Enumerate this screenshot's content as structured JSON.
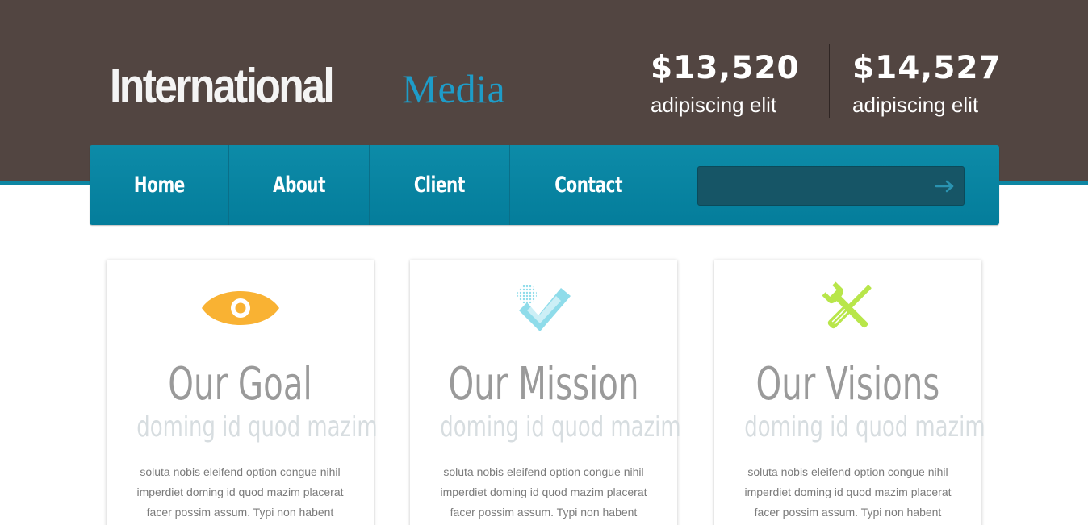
{
  "logo": {
    "main": "International",
    "sub": "Media"
  },
  "stats": [
    {
      "value": "$13,520",
      "label": "adipiscing elit"
    },
    {
      "value": "$14,527",
      "label": "adipiscing elit"
    }
  ],
  "nav": {
    "items": [
      {
        "label": "Home"
      },
      {
        "label": "About"
      },
      {
        "label": "Client"
      },
      {
        "label": "Contact"
      }
    ],
    "search": {
      "value": "",
      "placeholder": ""
    }
  },
  "cards": [
    {
      "icon": "eye-icon",
      "title": "Our Goal",
      "subtitle": "doming id quod mazim",
      "body": "soluta nobis eleifend option congue nihil imperdiet doming id quod mazim placerat facer possim assum. Typi non habent"
    },
    {
      "icon": "checkmark-badge-icon",
      "title": "Our Mission",
      "subtitle": "doming id quod mazim",
      "body": "soluta nobis eleifend option congue nihil imperdiet doming id quod mazim placerat facer possim assum. Typi non habent"
    },
    {
      "icon": "tools-icon",
      "title": "Our Visions",
      "subtitle": "doming id quod mazim",
      "body": "soluta nobis eleifend option congue nihil imperdiet doming id quod mazim placerat facer possim assum. Typi non habent"
    }
  ],
  "colors": {
    "header_bg": "#524541",
    "accent": "#0e86a3",
    "logo_sub": "#1e9cc8",
    "goal_icon": "#f9b233",
    "mission_icon": "#8fdcea",
    "visions_icon": "#b8e64a"
  }
}
